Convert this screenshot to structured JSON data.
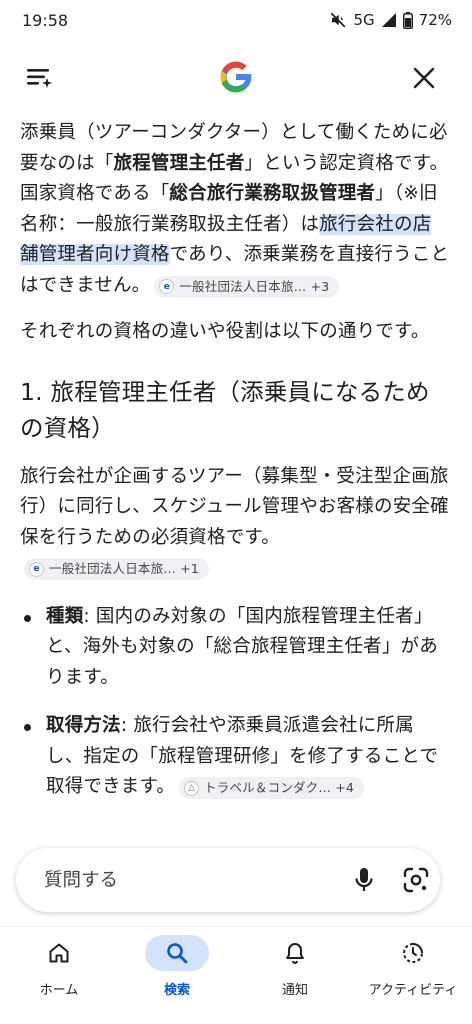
{
  "status_bar": {
    "time": "19:58",
    "network": "5G",
    "battery": "72%"
  },
  "content": {
    "para1": {
      "t1": "添乗員（ツアーコンダクター）として働くために必要なのは「",
      "b1": "旅程管理主任者",
      "t2": "」という認定資格です。国家資格である「",
      "b2": "総合旅行業務取扱管理者",
      "t3": "」（※旧名称：一般旅行業務取扱主任者）は",
      "hl": "旅行会社の店舗管理者向け資格",
      "t4": "であり、添乗業務を直接行うことはできません。",
      "chip": "一般社団法人日本旅… +3"
    },
    "para2": "それぞれの資格の違いや役割は以下の通りです。",
    "heading": "1. 旅程管理主任者（添乗員になるための資格）",
    "para3": {
      "text": "旅行会社が企画するツアー（募集型・受注型企画旅行）に同行し、スケジュール管理やお客様の安全確保を行うための必須資格です。",
      "chip": "一般社団法人日本旅… +1"
    },
    "bullets": [
      {
        "label": "種類",
        "text": ": 国内のみ対象の「国内旅程管理主任者」と、海外も対象の「総合旅程管理主任者」があります。"
      },
      {
        "label": "取得方法",
        "text": ": 旅行会社や添乗員派遣会社に所属し、指定の「旅程管理研修」を修了することで取得できます。",
        "chip": "トラベル＆コンダク… +4"
      }
    ]
  },
  "ask_bar": {
    "placeholder": "質問する"
  },
  "bottom_nav": {
    "items": [
      {
        "label": "ホーム",
        "icon": "home-icon"
      },
      {
        "label": "検索",
        "icon": "search-icon",
        "active": true
      },
      {
        "label": "通知",
        "icon": "bell-icon"
      },
      {
        "label": "アクティビティ",
        "icon": "activity-icon"
      }
    ]
  },
  "colors": {
    "highlight": "#d3e3fd",
    "active_nav": "#0b57d0",
    "text": "#1f1f1f",
    "chip_bg": "#eef0f3"
  }
}
